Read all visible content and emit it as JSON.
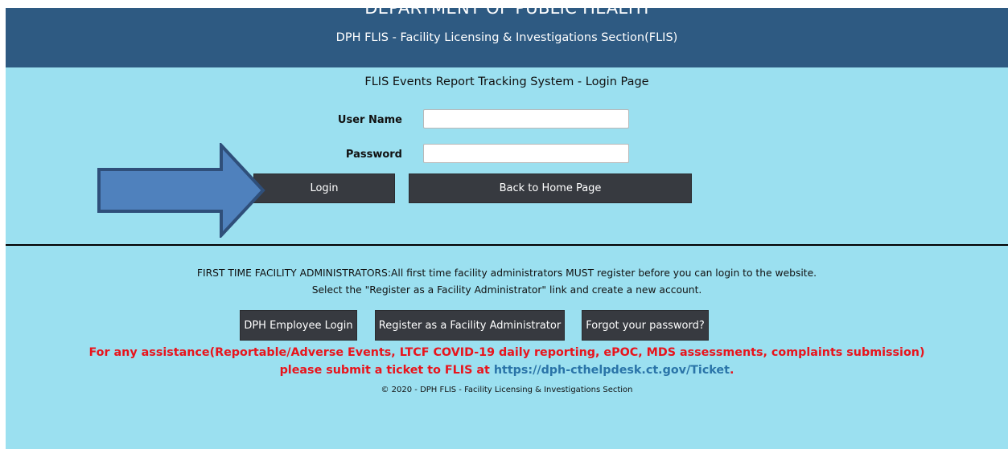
{
  "header": {
    "department": "DEPARTMENT OF PUBLIC HEALTH",
    "subtitle": "DPH FLIS - Facility Licensing & Investigations Section(FLIS)"
  },
  "login": {
    "page_title": "FLIS Events Report Tracking System - Login Page",
    "username_label": "User Name",
    "username_value": "",
    "password_label": "Password",
    "password_value": "",
    "login_button": "Login",
    "back_button": "Back to Home Page"
  },
  "annotation": {
    "icon": "arrow-right-icon",
    "fill_color": "#4f81bd",
    "stroke_color": "#2f4f7a"
  },
  "info": {
    "line1": "FIRST TIME FACILITY ADMINISTRATORS:All first time facility administrators MUST register before you can login to the website.",
    "line2": "Select the \"Register as a Facility Administrator\" link and create a new account.",
    "employee_login_button": "DPH Employee Login",
    "register_button": "Register as a Facility Administrator",
    "forgot_button": "Forgot your password?",
    "assist_line1": "For any assistance(Reportable/Adverse Events, LTCF COVID-19 daily reporting, ePOC, MDS assessments, complaints submission)",
    "assist_line2_prefix": "please submit a ticket to FLIS at ",
    "assist_link": "https://dph-cthelpdesk.ct.gov/Ticket",
    "assist_suffix": ".",
    "copyright": "© 2020 - DPH FLIS - Facility Licensing & Investigations Section"
  },
  "colors": {
    "header_bg": "#2e5a82",
    "page_bg": "#9be0f0",
    "button_bg": "#373a40",
    "alert_text": "#e8141c",
    "link_text": "#2a74a8"
  }
}
